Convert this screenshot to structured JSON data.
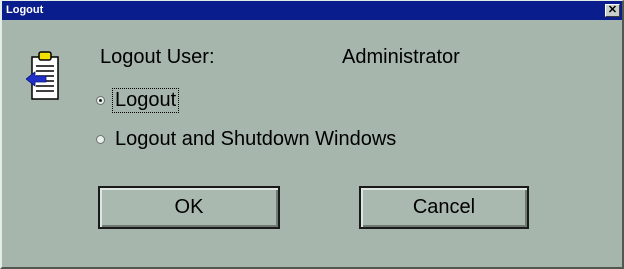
{
  "window": {
    "title": "Logout",
    "close_glyph": "✕"
  },
  "icon": "logout-clipboard-icon",
  "user": {
    "label": "Logout User:",
    "value": "Administrator"
  },
  "options": [
    {
      "label": "Logout",
      "selected": true
    },
    {
      "label": "Logout and Shutdown Windows",
      "selected": false
    }
  ],
  "buttons": {
    "ok": "OK",
    "cancel": "Cancel"
  },
  "colors": {
    "titlebar": "#0a1d8d",
    "dialog_bg": "#a6b6ad"
  }
}
